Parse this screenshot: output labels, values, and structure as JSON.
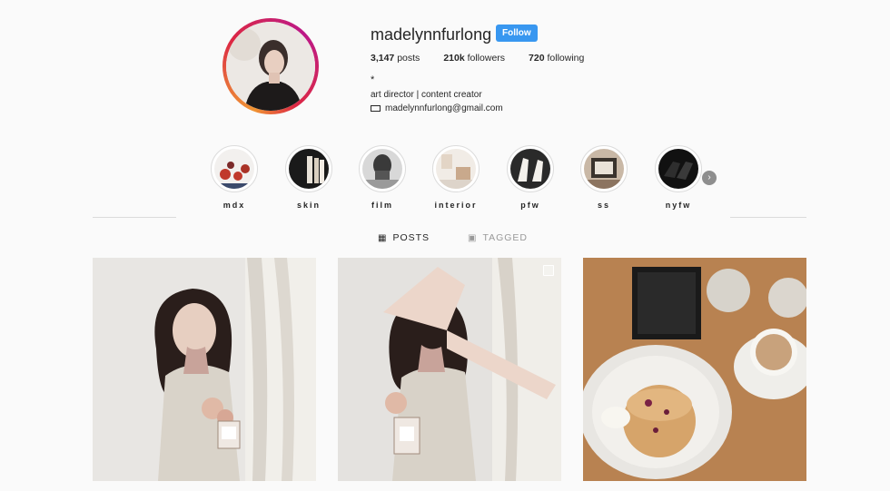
{
  "profile": {
    "username": "madelynnfurlong",
    "follow_label": "Follow",
    "posts_count": "3,147",
    "posts_label": "posts",
    "followers_count": "210k",
    "followers_label": "followers",
    "following_count": "720",
    "following_label": "following",
    "bio_star": "*",
    "bio_line": "art director | content creator",
    "email": "madelynnfurlong@gmail.com"
  },
  "highlights": [
    {
      "label": "mdx"
    },
    {
      "label": "skin"
    },
    {
      "label": "film"
    },
    {
      "label": "interior"
    },
    {
      "label": "pfw"
    },
    {
      "label": "ss"
    },
    {
      "label": "nyfw"
    }
  ],
  "tabs": {
    "posts_label": "POSTS",
    "tagged_label": "TAGGED"
  },
  "colors": {
    "follow_button": "#3897f0",
    "background": "#fafafa"
  },
  "icons": {
    "next": "chevron-right-icon",
    "email": "mail-icon",
    "posts_tab": "grid-icon",
    "tagged_tab": "tag-icon"
  }
}
